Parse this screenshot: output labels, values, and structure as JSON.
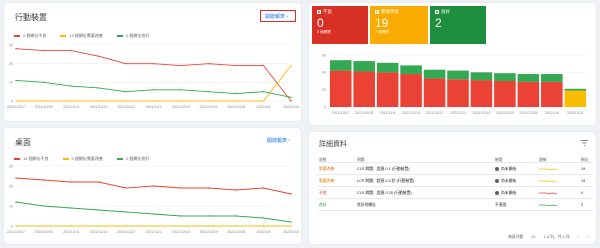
{
  "mobile_card": {
    "title": "行動裝置",
    "open_report": "開啟報表 ›",
    "legend": [
      {
        "label": "0 個網址不良",
        "color": "#ea4335"
      },
      {
        "label": "19 個網址需要改善",
        "color": "#fbbc04"
      },
      {
        "label": "2 個網址良好",
        "color": "#34a853"
      }
    ]
  },
  "desktop_card": {
    "title": "桌面",
    "open_report": "開啟報表 ›",
    "legend": [
      {
        "label": "16 個網址不良",
        "color": "#ea4335"
      },
      {
        "label": "0 個網址需要改善",
        "color": "#fbbc04"
      },
      {
        "label": "2 個網址良好",
        "color": "#34a853"
      }
    ]
  },
  "tiles": [
    {
      "label": "不良",
      "count": "0",
      "sub": "0 個問題",
      "color": "#d93025"
    },
    {
      "label": "需要改善",
      "count": "19",
      "sub": "2 個問題",
      "color": "#f9ab00"
    },
    {
      "label": "良好",
      "count": "2",
      "sub": "",
      "color": "#1e8e3e"
    }
  ],
  "details": {
    "title": "詳細資料",
    "filter_icon": "filter-icon",
    "headers": {
      "status": "狀態",
      "issue": "問題",
      "validation": "驗證",
      "trend": "趨勢",
      "pages": "網址"
    },
    "rows": [
      {
        "status": "需要改善",
        "status_color": "#e37400",
        "issue": "CLS 問題：超過 0.1 (行動裝置)",
        "validation": "尚未開始",
        "has_dot": true,
        "trend_color": "#fbbc04",
        "pages": "19"
      },
      {
        "status": "需要改善",
        "status_color": "#e37400",
        "issue": "LCP 問題：超過 2.5 秒 (行動裝置)",
        "validation": "尚未開始",
        "has_dot": true,
        "trend_color": "#fbbc04",
        "pages": "19"
      },
      {
        "status": "不良",
        "status_color": "#d93025",
        "issue": "CLS 問題：超過 0.25 (行動裝置)",
        "validation": "尚未開始",
        "has_dot": true,
        "trend_color": "#ea4335",
        "pages": "0"
      },
      {
        "status": "良好",
        "status_color": "#1e8e3e",
        "issue": "良好的網址",
        "validation": "不適用",
        "has_dot": false,
        "trend_color": "#34a853",
        "pages": "2"
      }
    ],
    "pager": {
      "rows_label": "每頁列數",
      "rows_value": "10",
      "range": "1-4 列，共 4 列",
      "prev": "‹",
      "next": "›"
    }
  },
  "chart_data": [
    {
      "type": "line",
      "title": "行動裝置",
      "x": [
        "2021/10/17",
        "2021/10/26",
        "2021/11/4",
        "2021/11/13",
        "2021/11/22",
        "2021/12/1",
        "2021/12/10",
        "2021/12/19",
        "2021/12/28",
        "2022/1/6",
        "2022/1/15"
      ],
      "ylim": [
        0,
        30
      ],
      "yticks": [
        0,
        10,
        20,
        30
      ],
      "series": [
        {
          "name": "0 個網址不良",
          "color": "#ea4335",
          "values": [
            28,
            27,
            27,
            24,
            20,
            20,
            19,
            20,
            19,
            19,
            0
          ]
        },
        {
          "name": "19 個網址需要改善",
          "color": "#fbbc04",
          "values": [
            0,
            0,
            0,
            0,
            0,
            0,
            0,
            0,
            0,
            0,
            19
          ]
        },
        {
          "name": "2 個網址良好",
          "color": "#34a853",
          "values": [
            11,
            10,
            8,
            7,
            5,
            6,
            6,
            5,
            4,
            5,
            2
          ]
        }
      ]
    },
    {
      "type": "line",
      "title": "桌面",
      "x": [
        "2021/10/17",
        "2021/10/26",
        "2021/11/4",
        "2021/11/13",
        "2021/11/22",
        "2021/12/1",
        "2021/12/10",
        "2021/12/19",
        "2021/12/28",
        "2022/1/6",
        "2022/1/15"
      ],
      "ylim": [
        0,
        30
      ],
      "yticks": [
        0,
        10,
        20,
        30
      ],
      "series": [
        {
          "name": "16 個網址不良",
          "color": "#ea4335",
          "values": [
            24,
            23,
            22,
            22,
            19,
            20,
            19,
            19,
            18,
            19,
            16
          ]
        },
        {
          "name": "0 個網址需要改善",
          "color": "#fbbc04",
          "values": [
            0,
            0,
            0,
            0,
            0,
            0,
            0,
            0,
            0,
            0,
            0
          ]
        },
        {
          "name": "2 個網址良好",
          "color": "#34a853",
          "values": [
            12,
            10,
            9,
            8,
            7,
            6,
            5,
            5,
            5,
            4,
            2
          ]
        }
      ]
    },
    {
      "type": "bar",
      "stacked": true,
      "x": [
        "2021/10/17",
        "2021/10/26",
        "2021/11/4",
        "2021/11/13",
        "2021/11/22",
        "2021/12/1",
        "2021/12/10",
        "2021/12/19",
        "2021/12/28",
        "2022/1/6",
        "2022/1/15"
      ],
      "ylim": [
        0,
        60
      ],
      "yticks": [
        0,
        20,
        40,
        60
      ],
      "series": [
        {
          "name": "不良",
          "color": "#ea4335",
          "values": [
            42,
            41,
            40,
            38,
            33,
            32,
            31,
            30,
            29,
            29,
            0
          ]
        },
        {
          "name": "需要改善",
          "color": "#fbbc04",
          "values": [
            0,
            0,
            0,
            0,
            0,
            0,
            0,
            0,
            0,
            0,
            19
          ]
        },
        {
          "name": "良好",
          "color": "#34a853",
          "values": [
            12,
            12,
            11,
            10,
            10,
            10,
            9,
            9,
            9,
            9,
            2
          ]
        }
      ]
    }
  ]
}
